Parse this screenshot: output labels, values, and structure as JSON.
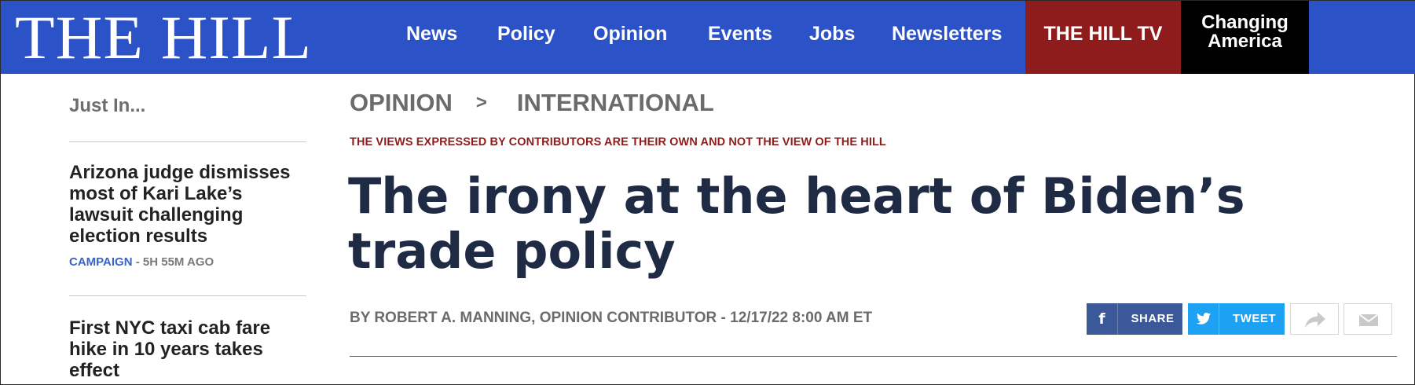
{
  "header": {
    "logo": "THE HILL",
    "nav": [
      "News",
      "Policy",
      "Opinion",
      "Events",
      "Jobs",
      "Newsletters"
    ],
    "hill_tv": "THE HILL TV",
    "changing_america": [
      "Changing",
      "America"
    ],
    "colors": {
      "bar": "#2c52c7",
      "hill_tv": "#8e1c1c",
      "changing_america": "#000000"
    }
  },
  "sidebar": {
    "title": "Just In...",
    "stories": [
      {
        "headline": "Arizona judge dismisses most of Kari Lake’s lawsuit challenging election results",
        "category": "CAMPAIGN",
        "time": " - 5H 55M AGO"
      },
      {
        "headline": "First NYC taxi cab fare hike in 10 years takes effect"
      }
    ]
  },
  "article": {
    "breadcrumb": [
      "OPINION",
      ">",
      "INTERNATIONAL"
    ],
    "disclaimer": "THE VIEWS EXPRESSED BY CONTRIBUTORS ARE THEIR OWN AND NOT THE VIEW OF THE HILL",
    "headline": "The irony at the heart of Biden’s trade policy",
    "byline": "BY ROBERT A. MANNING, OPINION CONTRIBUTOR - 12/17/22 8:00 AM ET"
  },
  "share": {
    "facebook": {
      "icon": "facebook-icon",
      "label": "SHARE",
      "color": "#3b5998"
    },
    "twitter": {
      "icon": "twitter-icon",
      "label": "TWEET",
      "color": "#1da1f2"
    },
    "more_icon": "share-arrow-icon",
    "email_icon": "email-icon"
  }
}
